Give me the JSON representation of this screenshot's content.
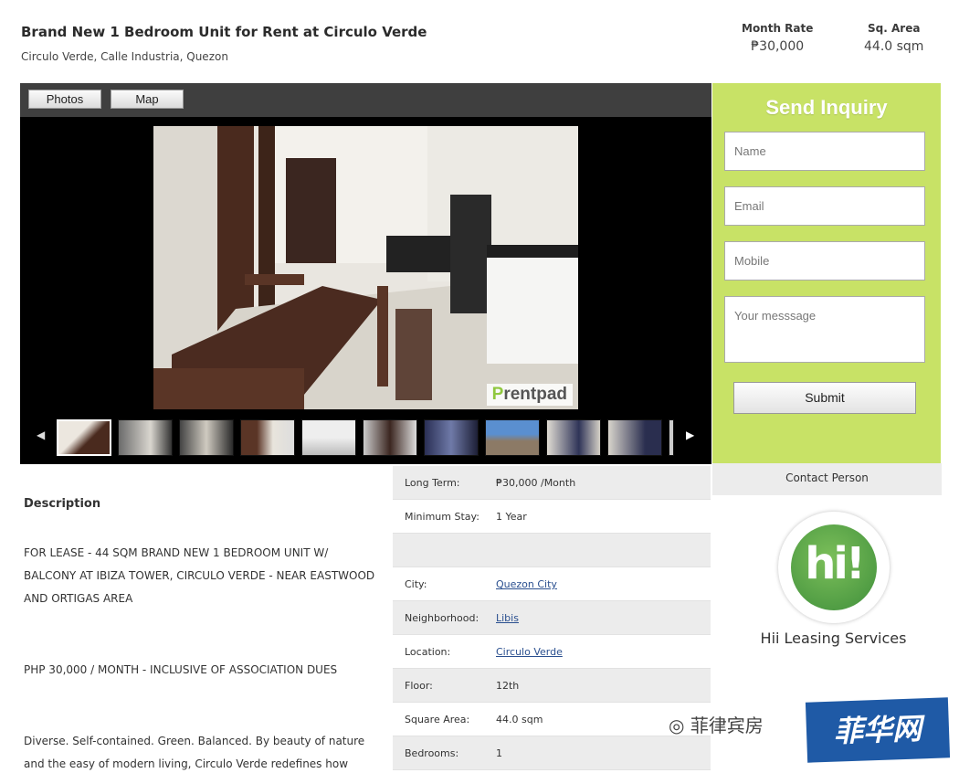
{
  "listing": {
    "title": "Brand New 1 Bedroom Unit for Rent at Circulo Verde",
    "address": "Circulo Verde, Calle Industria, Quezon",
    "month_rate_label": "Month Rate",
    "month_rate_value": "₱30,000",
    "area_label": "Sq. Area",
    "area_value": "44.0 sqm"
  },
  "gallery": {
    "tabs": [
      "Photos",
      "Map"
    ],
    "watermark_p": "P",
    "watermark_rest": "rentpad",
    "thumbnail_count": 11
  },
  "inquiry": {
    "heading": "Send Inquiry",
    "name_placeholder": "Name",
    "email_placeholder": "Email",
    "mobile_placeholder": "Mobile",
    "message_placeholder": "Your messsage",
    "submit_label": "Submit"
  },
  "contact": {
    "header": "Contact Person",
    "logo_text": "hi!",
    "company": "Hii Leasing Services"
  },
  "description": {
    "title": "Description",
    "paragraphs": [
      "FOR LEASE - 44 SQM BRAND NEW 1 BEDROOM UNIT W/ BALCONY AT IBIZA TOWER, CIRCULO VERDE - NEAR EASTWOOD AND ORTIGAS AREA",
      "PHP 30,000 / MONTH - INCLUSIVE OF ASSOCIATION DUES",
      "Diverse. Self-contained. Green. Balanced. By beauty of nature and the easy of modern living, Circulo Verde redefines how"
    ]
  },
  "details": [
    {
      "key": "Long Term:",
      "value": "₱30,000 /Month"
    },
    {
      "key": "Minimum Stay:",
      "value": "1 Year"
    },
    {
      "key": "",
      "value": ""
    },
    {
      "key": "City:",
      "value": "Quezon City"
    },
    {
      "key": "Neighborhood:",
      "value": "Libis"
    },
    {
      "key": "Location:",
      "value": "Circulo Verde"
    },
    {
      "key": "Floor:",
      "value": "12th"
    },
    {
      "key": "Square Area:",
      "value": "44.0 sqm"
    },
    {
      "key": "Bedrooms:",
      "value": "1"
    }
  ],
  "overlay": {
    "wechat_text": "菲律宾房",
    "stamp_text": "菲华网"
  },
  "colors": {
    "inquiry_bg": "#c8e266",
    "link": "#2a4f8f",
    "stamp_bg": "#1f5aa6"
  }
}
